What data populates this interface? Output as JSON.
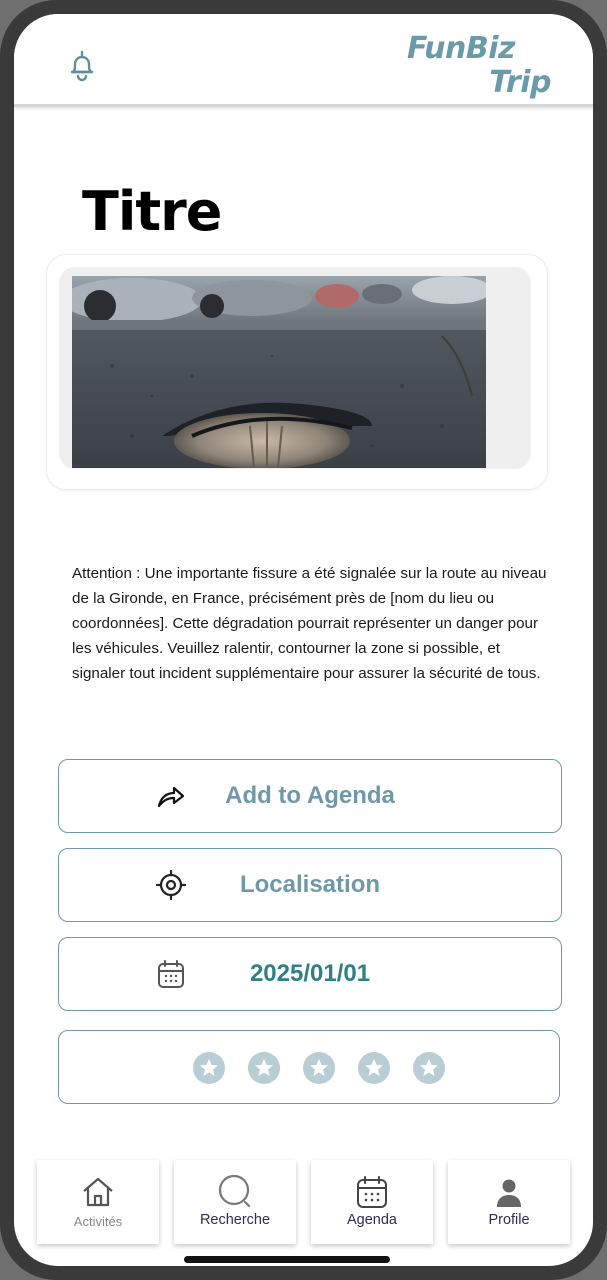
{
  "header": {
    "logo_line1": "FunBiz",
    "logo_line2": "Trip",
    "notification_icon": "bell-icon",
    "brand_color": "#6b9aab"
  },
  "main": {
    "title": "Titre",
    "image_alt": "Pothole on a road with cars parked in background",
    "description": "Attention : Une importante fissure a été signalée sur la route au niveau de la Gironde, en France, précisément près de [nom du lieu ou coordonnées]. Cette dégradation pourrait représenter un danger pour les véhicules. Veuillez ralentir, contourner la zone si possible, et signaler tout incident supplémentaire pour assurer la sécurité de tous."
  },
  "actions": {
    "add_to_agenda": {
      "label": "Add to Agenda",
      "icon": "share-arrow-icon"
    },
    "localisation": {
      "label": "Localisation",
      "icon": "target-icon"
    },
    "date": {
      "label": "2025/01/01",
      "icon": "calendar-icon"
    }
  },
  "rating": {
    "value": 0,
    "max": 5,
    "star_color": "#b8cdd4"
  },
  "bottom_nav": {
    "items": [
      {
        "label": "Activités",
        "icon": "home-icon"
      },
      {
        "label": "Recherche",
        "icon": "search-icon"
      },
      {
        "label": "Agenda",
        "icon": "calendar-icon"
      },
      {
        "label": "Profile",
        "icon": "user-icon"
      }
    ]
  }
}
